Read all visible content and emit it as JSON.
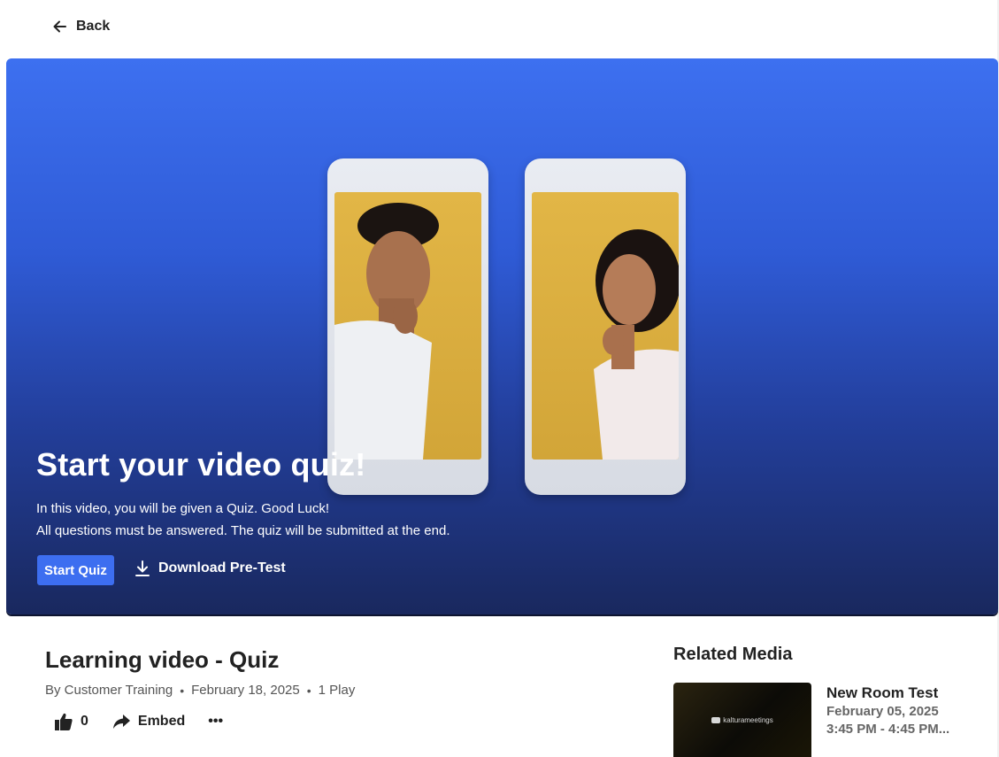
{
  "nav": {
    "back_label": "Back"
  },
  "hero": {
    "title": "Start your video quiz!",
    "line1": "In this video, you will be given a Quiz. Good Luck!",
    "line2": "All questions must be answered. The quiz will be submitted at the end.",
    "start_label": "Start Quiz",
    "download_label": "Download Pre-Test"
  },
  "media": {
    "title": "Learning video - Quiz",
    "author": "By Customer Training",
    "date": "February 18, 2025",
    "plays": "1 Play",
    "likes": "0",
    "embed_label": "Embed",
    "more_label": "•••"
  },
  "related": {
    "heading": "Related Media",
    "items": [
      {
        "title": "New Room Test",
        "date": "February 05, 2025",
        "time": "3:45 PM - 4:45 PM...",
        "thumb_text": "kalturameetings"
      }
    ]
  },
  "colors": {
    "accent": "#3d6ef0"
  }
}
